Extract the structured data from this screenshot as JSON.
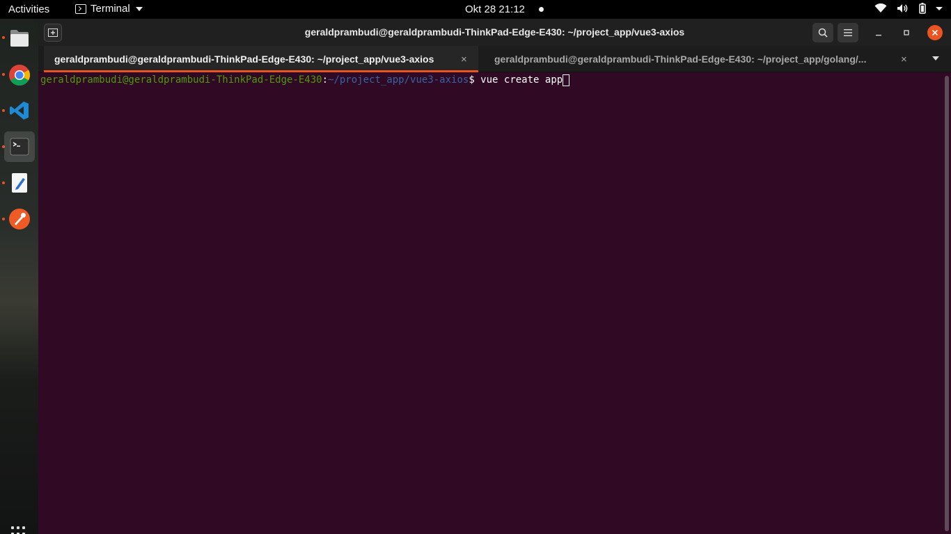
{
  "topbar": {
    "activities": "Activities",
    "app_name": "Terminal",
    "datetime": "Okt 28  21:12"
  },
  "dock": {
    "items": [
      {
        "name": "files-icon",
        "running": true
      },
      {
        "name": "chrome-icon",
        "running": true
      },
      {
        "name": "vscode-icon",
        "running": true
      },
      {
        "name": "terminal-icon",
        "running": true,
        "active": true
      },
      {
        "name": "text-editor-icon",
        "running": true
      },
      {
        "name": "postman-icon",
        "running": true
      }
    ]
  },
  "window": {
    "title": "geraldprambudi@geraldprambudi-ThinkPad-Edge-E430: ~/project_app/vue3-axios",
    "tabs": [
      {
        "label": "geraldprambudi@geraldprambudi-ThinkPad-Edge-E430: ~/project_app/vue3-axios",
        "active": true
      },
      {
        "label": "geraldprambudi@geraldprambudi-ThinkPad-Edge-E430: ~/project_app/golang/...",
        "active": false
      }
    ]
  },
  "terminal": {
    "prompt_user": "geraldprambudi@geraldprambudi-ThinkPad-Edge-E430",
    "prompt_sep": ":",
    "prompt_path": "~/project_app/vue3-axios",
    "prompt_symbol": "$ ",
    "command": "vue create app"
  },
  "colors": {
    "accent": "#e95420",
    "terminal_bg": "#300a24",
    "prompt_user": "#4e9a06",
    "prompt_path": "#3465a4"
  }
}
